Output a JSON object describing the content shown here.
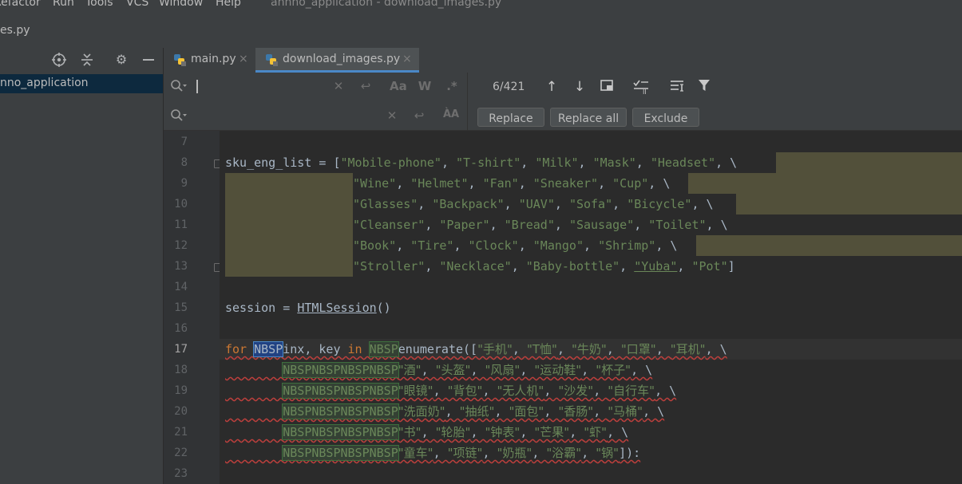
{
  "menu": {
    "refactor": "Refactor",
    "run": "Run",
    "tools": "Tools",
    "vcs": "VCS",
    "window": "Window",
    "help": "Help"
  },
  "window_title": "annno_application - download_images.py",
  "nav_file": "es.py",
  "project": {
    "selected": "nno_application"
  },
  "tabs": [
    {
      "label": "main.py",
      "close": "×"
    },
    {
      "label": "download_images.py",
      "close": "×"
    }
  ],
  "find": {
    "value": "",
    "match_count": "6/421",
    "icons": [
      "search-history-icon",
      "clear-icon",
      "newline-icon",
      "match-case-icon",
      "words-icon",
      "regex-icon"
    ]
  },
  "replace": {
    "value": "",
    "buttons": {
      "replace": "Replace",
      "replace_all": "Replace all",
      "exclude": "Exclude"
    }
  },
  "accent": "#4a88c7",
  "editor": {
    "line_numbers": [
      "7",
      "8",
      "9",
      "10",
      "11",
      "12",
      "13",
      "14",
      "15",
      "16",
      "17",
      "18",
      "19",
      "20",
      "21",
      "22",
      "23"
    ],
    "current_line": "17",
    "lines": {
      "l8": {
        "var": "sku_eng_list",
        "op": " = [",
        "items": [
          "\"Mobile-phone\"",
          "\"T-shirt\"",
          "\"Milk\"",
          "\"Mask\"",
          "\"Headset\""
        ],
        "tail": " \\"
      },
      "l9": {
        "items": [
          "\"Wine\"",
          "\"Helmet\"",
          "\"Fan\"",
          "\"Sneaker\"",
          "\"Cup\""
        ],
        "tail": " \\"
      },
      "l10": {
        "items": [
          "\"Glasses\"",
          "\"Backpack\"",
          "\"UAV\"",
          "\"Sofa\"",
          "\"Bicycle\""
        ],
        "tail": " \\"
      },
      "l11": {
        "items": [
          "\"Cleanser\"",
          "\"Paper\"",
          "\"Bread\"",
          "\"Sausage\"",
          "\"Toilet\""
        ],
        "tail": " \\"
      },
      "l12": {
        "items": [
          "\"Book\"",
          "\"Tire\"",
          "\"Clock\"",
          "\"Mango\"",
          "\"Shrimp\""
        ],
        "tail": " \\"
      },
      "l13": {
        "items": [
          "\"Stroller\"",
          "\"Necklace\"",
          "\"Baby-bottle\"",
          "\"Yuba\"",
          "\"Pot\""
        ],
        "tail": "]"
      },
      "l15": {
        "var": "session",
        "op": " = ",
        "call": "HTMLSession",
        "end": "()"
      },
      "l17": {
        "kw_for": "for",
        "nbsp": "NBSP",
        "mid": "inx, key ",
        "kw_in": "in",
        "fn": "enumerate([",
        "items": [
          "\"手机\"",
          "\"T恤\"",
          "\"牛奶\"",
          "\"口罩\"",
          "\"耳机\""
        ],
        "tail": " \\"
      },
      "l18": {
        "nbsp4": "NBSPNBSPNBSPNBSP",
        "items": [
          "\"酒\"",
          "\"头盔\"",
          "\"风扇\"",
          "\"运动鞋\"",
          "\"杯子\""
        ],
        "tail": " \\"
      },
      "l19": {
        "nbsp4": "NBSPNBSPNBSPNBSP",
        "items": [
          "\"眼镜\"",
          "\"背包\"",
          "\"无人机\"",
          "\"沙发\"",
          "\"自行车\""
        ],
        "tail": " \\"
      },
      "l20": {
        "nbsp4": "NBSPNBSPNBSPNBSP",
        "items": [
          "\"洗面奶\"",
          "\"抽纸\"",
          "\"面包\"",
          "\"香肠\"",
          "\"马桶\""
        ],
        "tail": " \\"
      },
      "l21": {
        "nbsp4": "NBSPNBSPNBSPNBSP",
        "items": [
          "\"书\"",
          "\"轮胎\"",
          "\"钟表\"",
          "\"芒果\"",
          "\"虾\""
        ],
        "tail": " \\"
      },
      "l22": {
        "nbsp4": "NBSPNBSPNBSPNBSP",
        "items": [
          "\"童车\"",
          "\"项链\"",
          "\"奶瓶\"",
          "\"浴霸\"",
          "\"锅\""
        ],
        "tail": "]):"
      }
    }
  }
}
